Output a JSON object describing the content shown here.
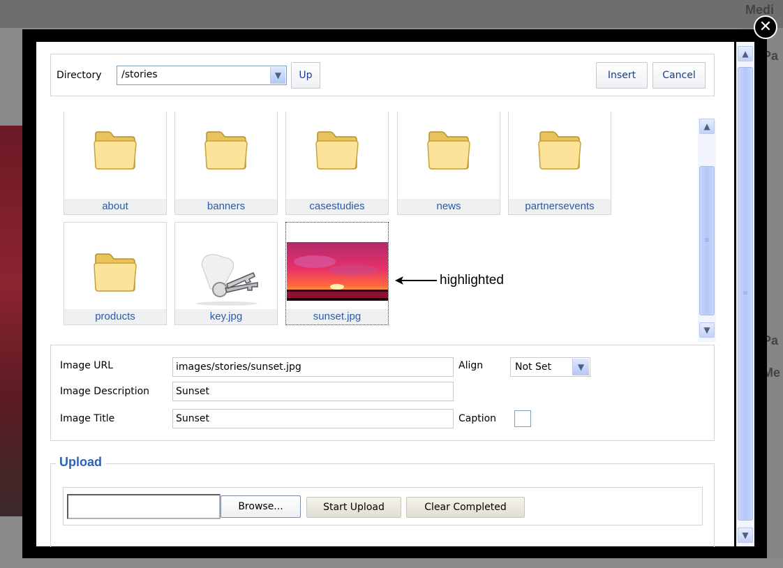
{
  "background": {
    "labels": [
      "Medi",
      "Pa",
      "Pa",
      "Me"
    ]
  },
  "toolbar": {
    "directory_label": "Directory",
    "directory_value": "/stories",
    "up_label": "Up",
    "insert_label": "Insert",
    "cancel_label": "Cancel"
  },
  "files": [
    {
      "name": "about",
      "type": "folder"
    },
    {
      "name": "banners",
      "type": "folder"
    },
    {
      "name": "casestudies",
      "type": "folder"
    },
    {
      "name": "news",
      "type": "folder"
    },
    {
      "name": "partnersevents",
      "type": "folder"
    },
    {
      "name": "products",
      "type": "folder"
    },
    {
      "name": "key.jpg",
      "type": "image"
    },
    {
      "name": "sunset.jpg",
      "type": "image",
      "selected": true
    }
  ],
  "annotation": "highlighted",
  "properties": {
    "image_url_label": "Image URL",
    "image_url_value": "images/stories/sunset.jpg",
    "description_label": "Image Description",
    "description_value": "Sunset",
    "title_label": "Image Title",
    "title_value": "Sunset",
    "align_label": "Align",
    "align_value": "Not Set",
    "caption_label": "Caption",
    "caption_checked": false
  },
  "upload": {
    "legend": "Upload",
    "file_value": "",
    "browse_label": "Browse...",
    "start_label": "Start Upload",
    "clear_label": "Clear Completed"
  },
  "close_glyph": "✕",
  "colors": {
    "link_blue": "#2a5aa8",
    "legend_blue": "#2a62b8",
    "modal_frame": "#000000"
  }
}
